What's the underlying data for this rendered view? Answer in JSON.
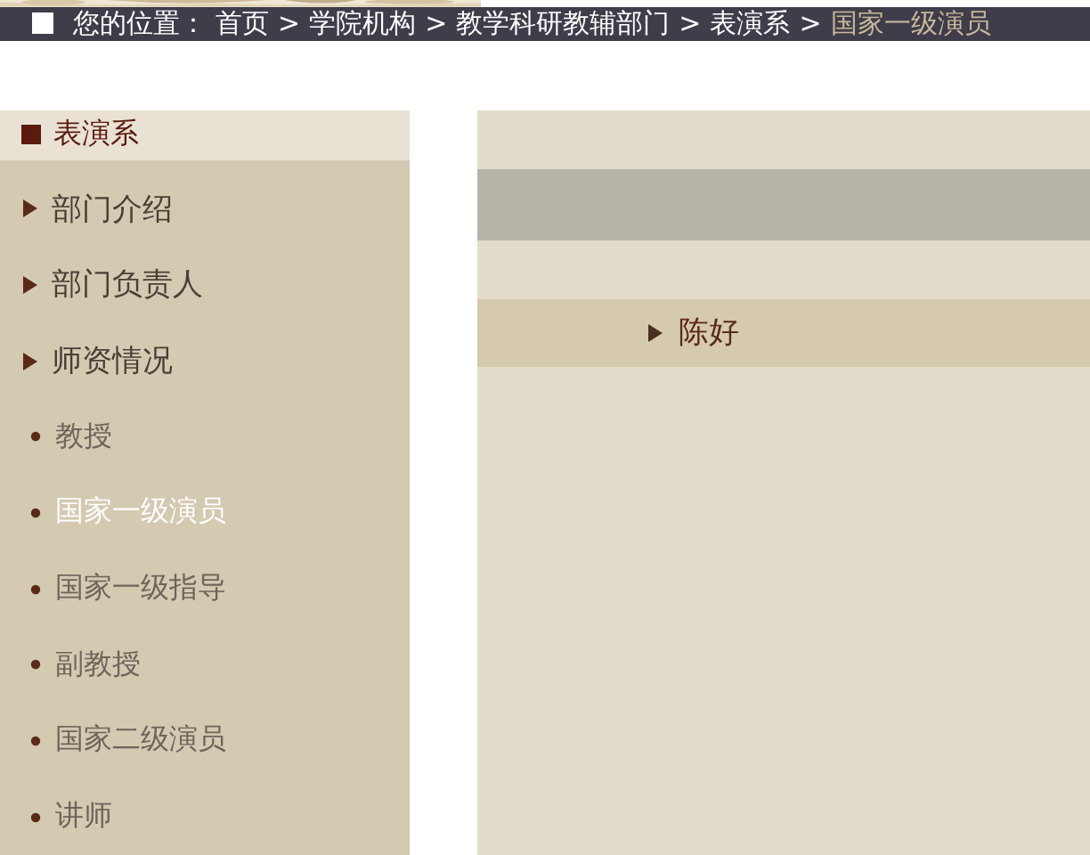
{
  "breadcrumb": {
    "label": "您的位置：",
    "items": [
      {
        "text": "首页",
        "current": false
      },
      {
        "text": "学院机构",
        "current": false
      },
      {
        "text": "教学科研教辅部门",
        "current": false
      },
      {
        "text": "表演系",
        "current": false
      },
      {
        "text": "国家一级演员",
        "current": true
      }
    ],
    "separator": ">"
  },
  "sidebar": {
    "title": "表演系",
    "items": [
      {
        "kind": "section",
        "label": "部门介绍",
        "selected": false
      },
      {
        "kind": "section",
        "label": "部门负责人",
        "selected": false
      },
      {
        "kind": "section",
        "label": "师资情况",
        "selected": false
      },
      {
        "kind": "sub",
        "label": "教授",
        "selected": false
      },
      {
        "kind": "sub",
        "label": "国家一级演员",
        "selected": true
      },
      {
        "kind": "sub",
        "label": "国家一级指导",
        "selected": false
      },
      {
        "kind": "sub",
        "label": "副教授",
        "selected": false
      },
      {
        "kind": "sub",
        "label": "国家二级演员",
        "selected": false
      },
      {
        "kind": "sub",
        "label": "讲师",
        "selected": false
      }
    ]
  },
  "content": {
    "people": [
      {
        "name": "陈好"
      }
    ]
  }
}
